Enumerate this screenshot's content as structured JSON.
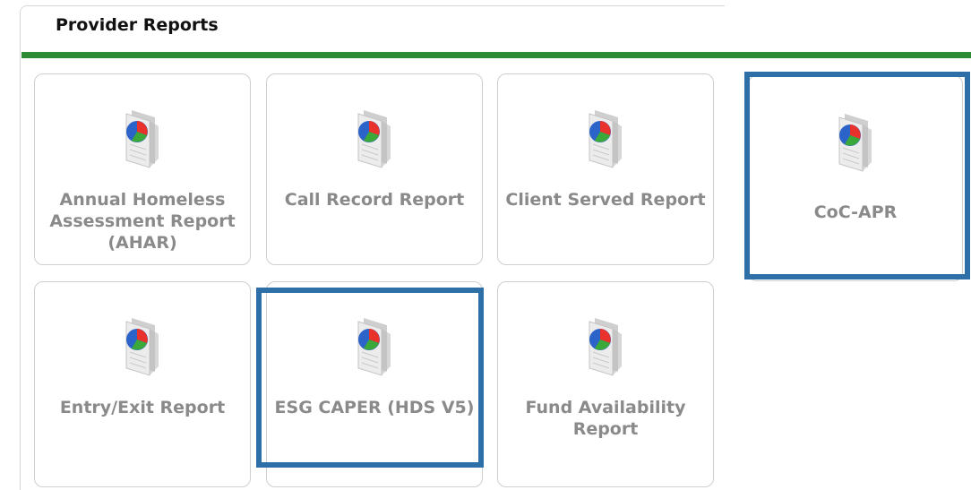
{
  "panel": {
    "title": "Provider Reports"
  },
  "reports": [
    {
      "label": "Annual Homeless Assessment Report (AHAR)"
    },
    {
      "label": "Call Record Report"
    },
    {
      "label": "Client Served Report"
    },
    {
      "label": "CoC-APR"
    },
    {
      "label": "Entry/Exit Report"
    },
    {
      "label": "ESG CAPER (HDS V5)"
    },
    {
      "label": "Fund Availability Report"
    }
  ],
  "icon": {
    "name": "pie-chart-report-icon",
    "colors": {
      "red": "#e8322b",
      "green": "#3aa93a",
      "blue": "#2b63c9",
      "doc": "#e9e9e9"
    }
  },
  "highlight_color": "#2e6fa8"
}
